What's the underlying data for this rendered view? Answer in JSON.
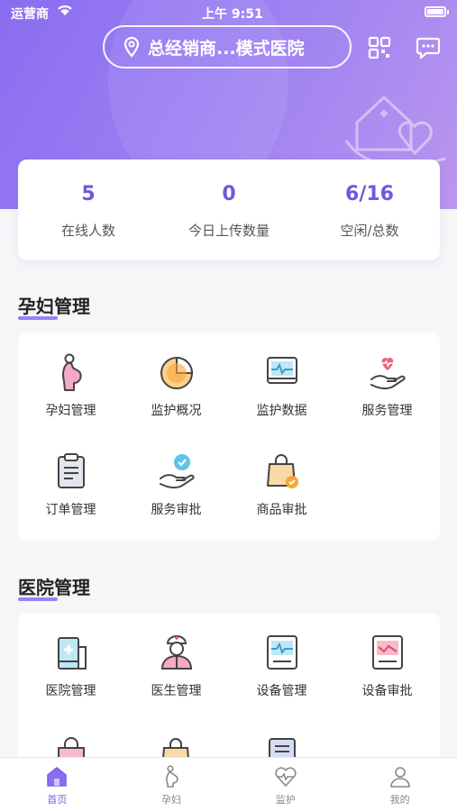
{
  "status_bar": {
    "carrier": "运营商",
    "time": "上午 9:51"
  },
  "header": {
    "location": "总经销商...模式医院"
  },
  "stats": [
    {
      "value": "5",
      "label": "在线人数"
    },
    {
      "value": "0",
      "label": "今日上传数量"
    },
    {
      "value": "6/16",
      "label": "空闲/总数"
    }
  ],
  "sections": {
    "pregnant": {
      "title": "孕妇管理",
      "items": [
        {
          "label": "孕妇管理",
          "icon": "pregnant-woman-icon"
        },
        {
          "label": "监护概况",
          "icon": "pie-chart-icon"
        },
        {
          "label": "监护数据",
          "icon": "monitor-data-icon"
        },
        {
          "label": "服务管理",
          "icon": "hand-heart-icon"
        },
        {
          "label": "订单管理",
          "icon": "clipboard-icon"
        },
        {
          "label": "服务审批",
          "icon": "hand-check-icon"
        },
        {
          "label": "商品审批",
          "icon": "bag-check-icon"
        }
      ]
    },
    "hospital": {
      "title": "医院管理",
      "items": [
        {
          "label": "医院管理",
          "icon": "hospital-building-icon"
        },
        {
          "label": "医生管理",
          "icon": "doctor-icon"
        },
        {
          "label": "设备管理",
          "icon": "device-monitor-icon"
        },
        {
          "label": "设备审批",
          "icon": "device-approve-icon"
        }
      ]
    }
  },
  "tabbar": [
    {
      "label": "首页",
      "icon": "home-icon",
      "active": true
    },
    {
      "label": "孕妇",
      "icon": "pregnant-icon",
      "active": false
    },
    {
      "label": "监护",
      "icon": "heart-monitor-icon",
      "active": false
    },
    {
      "label": "我的",
      "icon": "user-icon",
      "active": false
    }
  ],
  "colors": {
    "accent": "#7a5ee6",
    "hero_start": "#8a6df0",
    "hero_end": "#b996ee"
  }
}
